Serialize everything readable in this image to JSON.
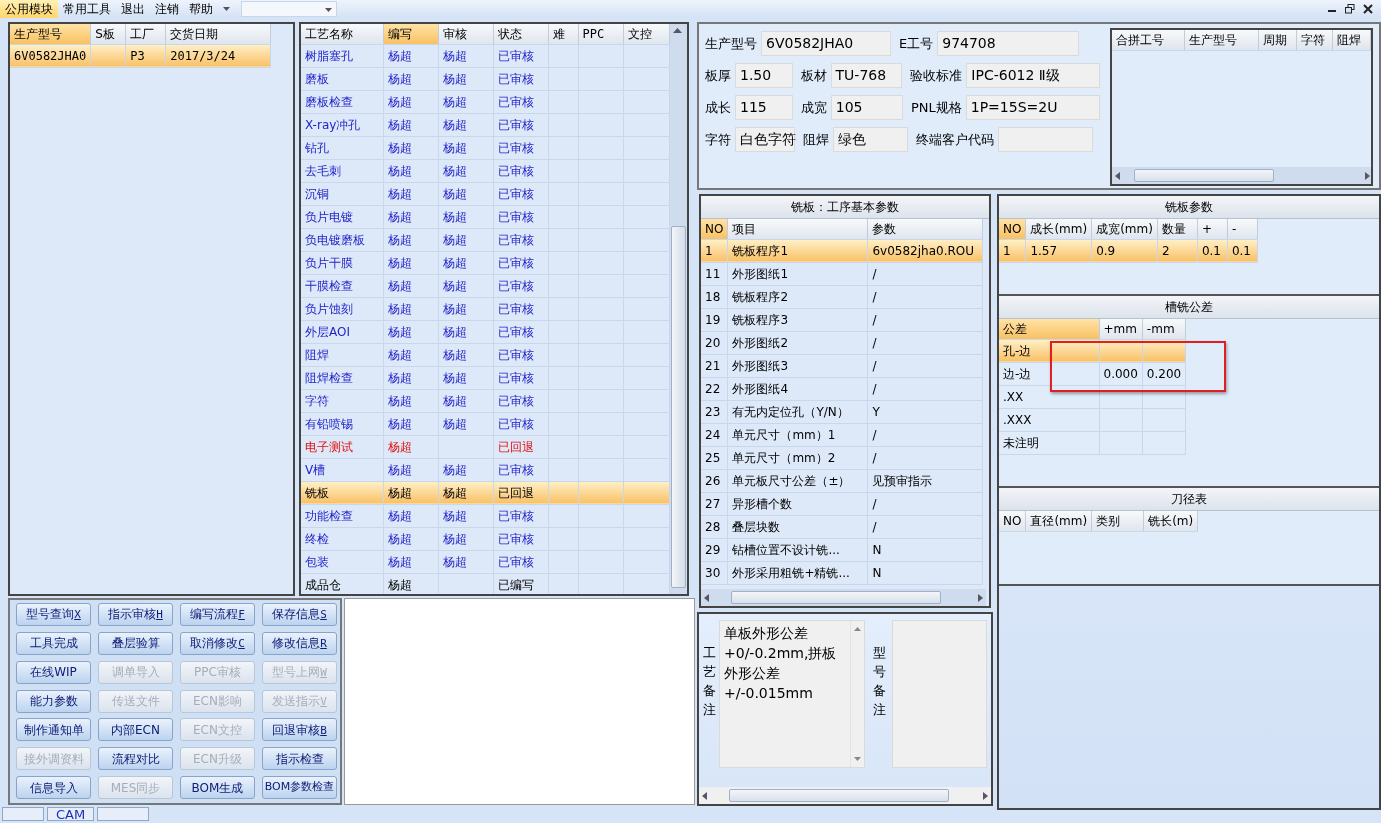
{
  "menu": {
    "items": [
      {
        "label": "公用模块",
        "selected": true
      },
      {
        "label": "常用工具",
        "selected": false
      },
      {
        "label": "退出",
        "selected": false
      },
      {
        "label": "注销",
        "selected": false
      },
      {
        "label": "帮助",
        "selected": false
      }
    ]
  },
  "order_list": {
    "columns": [
      {
        "label": "生产型号",
        "highlighted": true
      },
      {
        "label": "S板",
        "highlighted": false
      },
      {
        "label": "工厂",
        "highlighted": false
      },
      {
        "label": "交货日期",
        "highlighted": false
      }
    ],
    "rows": [
      {
        "cells": [
          "6V0582JHA0",
          "",
          "P3",
          "2017/3/24"
        ],
        "selected": true
      }
    ]
  },
  "process_table": {
    "columns": [
      {
        "label": "工艺名称",
        "highlighted": false
      },
      {
        "label": "编写",
        "highlighted": true
      },
      {
        "label": "审核",
        "highlighted": false
      },
      {
        "label": "状态",
        "highlighted": false
      },
      {
        "label": "难",
        "highlighted": false
      },
      {
        "label": "PPC",
        "highlighted": false
      },
      {
        "label": "文控",
        "highlighted": false
      }
    ],
    "rows": [
      {
        "name": "树脂塞孔",
        "writer": "杨超",
        "reviewer": "杨超",
        "status": "已审核",
        "kind": "reviewed",
        "selected": false
      },
      {
        "name": "磨板",
        "writer": "杨超",
        "reviewer": "杨超",
        "status": "已审核",
        "kind": "reviewed",
        "selected": false
      },
      {
        "name": "磨板检查",
        "writer": "杨超",
        "reviewer": "杨超",
        "status": "已审核",
        "kind": "reviewed",
        "selected": false
      },
      {
        "name": "X-ray冲孔",
        "writer": "杨超",
        "reviewer": "杨超",
        "status": "已审核",
        "kind": "reviewed",
        "selected": false
      },
      {
        "name": "钻孔",
        "writer": "杨超",
        "reviewer": "杨超",
        "status": "已审核",
        "kind": "reviewed",
        "selected": false
      },
      {
        "name": "去毛刺",
        "writer": "杨超",
        "reviewer": "杨超",
        "status": "已审核",
        "kind": "reviewed",
        "selected": false
      },
      {
        "name": "沉铜",
        "writer": "杨超",
        "reviewer": "杨超",
        "status": "已审核",
        "kind": "reviewed",
        "selected": false
      },
      {
        "name": "负片电镀",
        "writer": "杨超",
        "reviewer": "杨超",
        "status": "已审核",
        "kind": "reviewed",
        "selected": false
      },
      {
        "name": "负电镀磨板",
        "writer": "杨超",
        "reviewer": "杨超",
        "status": "已审核",
        "kind": "reviewed",
        "selected": false
      },
      {
        "name": "负片干膜",
        "writer": "杨超",
        "reviewer": "杨超",
        "status": "已审核",
        "kind": "reviewed",
        "selected": false
      },
      {
        "name": "干膜检查",
        "writer": "杨超",
        "reviewer": "杨超",
        "status": "已审核",
        "kind": "reviewed",
        "selected": false
      },
      {
        "name": "负片蚀刻",
        "writer": "杨超",
        "reviewer": "杨超",
        "status": "已审核",
        "kind": "reviewed",
        "selected": false
      },
      {
        "name": "外层AOI",
        "writer": "杨超",
        "reviewer": "杨超",
        "status": "已审核",
        "kind": "reviewed",
        "selected": false
      },
      {
        "name": "阻焊",
        "writer": "杨超",
        "reviewer": "杨超",
        "status": "已审核",
        "kind": "reviewed",
        "selected": false
      },
      {
        "name": "阻焊检查",
        "writer": "杨超",
        "reviewer": "杨超",
        "status": "已审核",
        "kind": "reviewed",
        "selected": false
      },
      {
        "name": "字符",
        "writer": "杨超",
        "reviewer": "杨超",
        "status": "已审核",
        "kind": "reviewed",
        "selected": false
      },
      {
        "name": "有铅喷锡",
        "writer": "杨超",
        "reviewer": "杨超",
        "status": "已审核",
        "kind": "reviewed",
        "selected": false
      },
      {
        "name": "电子测试",
        "writer": "杨超",
        "status": "已回退",
        "kind": "returned",
        "selected": false
      },
      {
        "name": "V槽",
        "writer": "杨超",
        "reviewer": "杨超",
        "status": "已审核",
        "kind": "reviewed",
        "selected": false
      },
      {
        "name": "铣板",
        "writer": "杨超",
        "reviewer": "杨超",
        "status": "已回退",
        "selected": true
      },
      {
        "name": "功能检查",
        "writer": "杨超",
        "reviewer": "杨超",
        "status": "已审核",
        "kind": "reviewed",
        "selected": false
      },
      {
        "name": "终检",
        "writer": "杨超",
        "reviewer": "杨超",
        "status": "已审核",
        "kind": "reviewed",
        "selected": false
      },
      {
        "name": "包装",
        "writer": "杨超",
        "reviewer": "杨超",
        "status": "已审核",
        "kind": "reviewed",
        "selected": false
      },
      {
        "name": "成品仓",
        "writer": "杨超",
        "status": "已编写",
        "kind": "written",
        "selected": false
      }
    ]
  },
  "buttons": [
    {
      "label": "型号查询",
      "key": "X",
      "disabled": false
    },
    {
      "label": "指示审核",
      "key": "H",
      "disabled": false
    },
    {
      "label": "编写流程",
      "key": "F",
      "disabled": false
    },
    {
      "label": "保存信息",
      "key": "S",
      "disabled": false
    },
    {
      "label": "工具完成",
      "disabled": false
    },
    {
      "label": "叠层验算",
      "disabled": false
    },
    {
      "label": "取消修改",
      "key": "C",
      "disabled": false
    },
    {
      "label": "修改信息",
      "key": "R",
      "disabled": false
    },
    {
      "label": "在线WIP",
      "disabled": false
    },
    {
      "label": "调单导入",
      "disabled": true
    },
    {
      "label": "PPC审核",
      "disabled": true
    },
    {
      "label": "型号上网",
      "key": "W",
      "disabled": true
    },
    {
      "label": "能力参数",
      "disabled": false
    },
    {
      "label": "传送文件",
      "disabled": true
    },
    {
      "label": "ECN影响",
      "disabled": true
    },
    {
      "label": "发送指示",
      "key": "V",
      "disabled": true
    },
    {
      "label": "制作通知单",
      "disabled": false
    },
    {
      "label": "内部ECN",
      "disabled": false
    },
    {
      "label": "ECN文控",
      "disabled": true
    },
    {
      "label": "回退审核",
      "key": "B",
      "disabled": false
    },
    {
      "label": "接外调资料",
      "disabled": true
    },
    {
      "label": "流程对比",
      "disabled": false
    },
    {
      "label": "ECN升级",
      "disabled": true
    },
    {
      "label": "指示检查",
      "disabled": false
    },
    {
      "label": "信息导入",
      "disabled": false
    },
    {
      "label": "MES同步",
      "disabled": true
    },
    {
      "label": "BOM生成",
      "disabled": false
    },
    {
      "label": "BOM参数检查",
      "disabled": false
    }
  ],
  "info_form": {
    "lines": [
      {
        "fields": [
          {
            "label": "生产型号",
            "value": "6V0582JHA0"
          },
          {
            "label": "E工号",
            "value": "974708"
          }
        ]
      },
      {
        "fields": [
          {
            "label": "板厚",
            "value": "1.50"
          },
          {
            "label": "板材",
            "value": "TU-768"
          },
          {
            "label": "验收标准",
            "value": "IPC-6012 Ⅱ级"
          }
        ]
      },
      {
        "fields": [
          {
            "label": "成长",
            "value": "115"
          },
          {
            "label": "成宽",
            "value": "105"
          },
          {
            "label": "PNL规格",
            "value": "1P=15S=2U"
          }
        ]
      },
      {
        "fields": [
          {
            "label": "字符",
            "value": "白色字符"
          },
          {
            "label": "阻焊",
            "value": "绿色"
          },
          {
            "label": "终端客户代码"
          }
        ]
      }
    ]
  },
  "combined_table": {
    "columns": [
      {
        "label": "合拼工号",
        "highlighted": false
      },
      {
        "label": "生产型号",
        "highlighted": false
      },
      {
        "label": "周期",
        "highlighted": false
      },
      {
        "label": "字符",
        "highlighted": false
      },
      {
        "label": "阻焊",
        "highlighted": false
      }
    ]
  },
  "milling_basic": {
    "title": "铣板：工序基本参数",
    "columns": [
      {
        "label": "NO",
        "highlighted": true
      },
      {
        "label": "项目",
        "highlighted": false
      },
      {
        "label": "参数",
        "highlighted": false
      }
    ],
    "rows": [
      {
        "cells": [
          "1",
          "铣板程序1",
          "6v0582jha0.ROU"
        ],
        "selected": true
      },
      {
        "cells": [
          "11",
          "外形图纸1",
          "/"
        ],
        "selected": false
      },
      {
        "cells": [
          "18",
          "铣板程序2",
          "/"
        ],
        "selected": false
      },
      {
        "cells": [
          "19",
          "铣板程序3",
          "/"
        ],
        "selected": false
      },
      {
        "cells": [
          "20",
          "外形图纸2",
          "/"
        ],
        "selected": false
      },
      {
        "cells": [
          "21",
          "外形图纸3",
          "/"
        ],
        "selected": false
      },
      {
        "cells": [
          "22",
          "外形图纸4",
          "/"
        ],
        "selected": false
      },
      {
        "cells": [
          "23",
          "有无内定位孔（Y/N）",
          "Y"
        ],
        "selected": false
      },
      {
        "cells": [
          "24",
          "单元尺寸（mm）1",
          "/"
        ],
        "selected": false
      },
      {
        "cells": [
          "25",
          "单元尺寸（mm）2",
          "/"
        ],
        "selected": false
      },
      {
        "cells": [
          "26",
          "单元板尺寸公差（±）",
          "见预审指示"
        ],
        "selected": false
      },
      {
        "cells": [
          "27",
          "异形槽个数",
          "/"
        ],
        "selected": false
      },
      {
        "cells": [
          "28",
          "叠层块数",
          "/"
        ],
        "selected": false
      },
      {
        "cells": [
          "29",
          "钻槽位置不设计铣...",
          "N"
        ],
        "selected": false
      },
      {
        "cells": [
          "30",
          "外形采用粗铣+精铣...",
          "N"
        ],
        "selected": false
      }
    ]
  },
  "milling_params": {
    "title": "铣板参数",
    "columns": [
      {
        "label": "NO",
        "highlighted": true
      },
      {
        "label": "成长(mm)",
        "highlighted": false
      },
      {
        "label": "成宽(mm)",
        "highlighted": false
      },
      {
        "label": "数量",
        "highlighted": false
      },
      {
        "label": "+",
        "highlighted": false
      },
      {
        "label": "-",
        "highlighted": false
      }
    ],
    "rows": [
      {
        "cells": [
          "1",
          "1.57",
          "0.9",
          "2",
          "0.1",
          "0.1"
        ],
        "selected": true
      }
    ]
  },
  "slot_tolerance": {
    "title": "槽铣公差",
    "columns": [
      {
        "label": "公差",
        "highlighted": true
      },
      {
        "label": "+mm",
        "highlighted": false
      },
      {
        "label": "-mm",
        "highlighted": false
      }
    ],
    "rows": [
      {
        "cells": [
          "孔-边",
          "",
          ""
        ],
        "selected": true
      },
      {
        "cells": [
          "边-边",
          "0.000",
          "0.200"
        ],
        "selected": false
      },
      {
        "cells": [
          ".XX",
          "",
          ""
        ],
        "selected": false
      },
      {
        "cells": [
          ".XXX",
          "",
          ""
        ],
        "selected": false
      },
      {
        "cells": [
          "未注明",
          "",
          ""
        ],
        "selected": false
      }
    ]
  },
  "tool_diameter": {
    "title": "刀径表",
    "columns": [
      {
        "label": "NO",
        "highlighted": false
      },
      {
        "label": "直径(mm)",
        "highlighted": false
      },
      {
        "label": "类别",
        "highlighted": false
      },
      {
        "label": "铣长(m)",
        "highlighted": false
      }
    ]
  },
  "remarks": {
    "process_label": "工艺备注",
    "process_text": "单板外形公差+0/-0.2mm,拼板外形公差+/-0.015mm",
    "model_label": "型号备注"
  },
  "bottom_tabs": [
    {
      "label": "CAM"
    }
  ]
}
